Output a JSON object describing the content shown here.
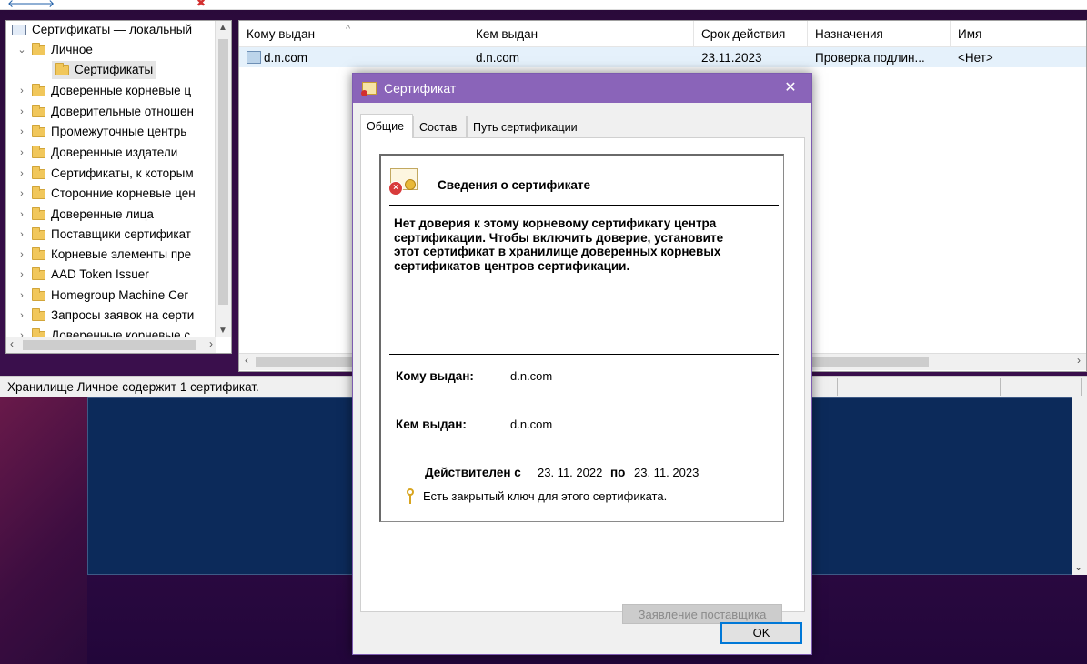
{
  "window": {
    "status_text": "Хранилище Личное содержит 1 сертификат."
  },
  "tree": {
    "root": "Сертификаты — локальный",
    "items": [
      {
        "label": "Личное",
        "expanded": true
      },
      {
        "label": "Сертификаты",
        "selected": true
      },
      {
        "label": "Доверенные корневые ц"
      },
      {
        "label": "Доверительные отношен"
      },
      {
        "label": "Промежуточные центрь"
      },
      {
        "label": "Доверенные издатели"
      },
      {
        "label": "Сертификаты, к которым"
      },
      {
        "label": "Сторонние корневые цен"
      },
      {
        "label": "Доверенные лица"
      },
      {
        "label": "Поставщики сертификат"
      },
      {
        "label": "Корневые элементы пре"
      },
      {
        "label": "AAD Token Issuer"
      },
      {
        "label": "Homegroup Machine Cer"
      },
      {
        "label": "Запросы заявок на серти"
      },
      {
        "label": "Доверенные корневые с"
      }
    ]
  },
  "list": {
    "columns": [
      "Кому выдан",
      "Кем выдан",
      "Срок действия",
      "Назначения",
      "Имя"
    ],
    "rows": [
      {
        "issued_to": "d.n.com",
        "issued_by": "d.n.com",
        "expires": "23.11.2023",
        "purposes": "Проверка подлин...",
        "name": "<Нет>"
      }
    ]
  },
  "dialog": {
    "title": "Сертификат",
    "tabs": [
      "Общие",
      "Состав",
      "Путь сертификации"
    ],
    "info_title": "Сведения о сертификате",
    "warning": "Нет доверия к этому корневому сертификату центра сертификации. Чтобы включить  доверие, установите этот сертификат в хранилище доверенных корневых сертификатов центров сертификации.",
    "issued_to_label": "Кому выдан:",
    "issued_to_value": "d.n.com",
    "issued_by_label": "Кем выдан:",
    "issued_by_value": "d.n.com",
    "valid_from_label": "Действителен с",
    "valid_from": "23. 11. 2022",
    "valid_to_label": "по",
    "valid_to": "23. 11. 2023",
    "private_key_text": "Есть закрытый ключ для этого сертификата.",
    "issuer_statement_button": "Заявление поставщика",
    "ok_button": "OK",
    "close_glyph": "✕"
  }
}
